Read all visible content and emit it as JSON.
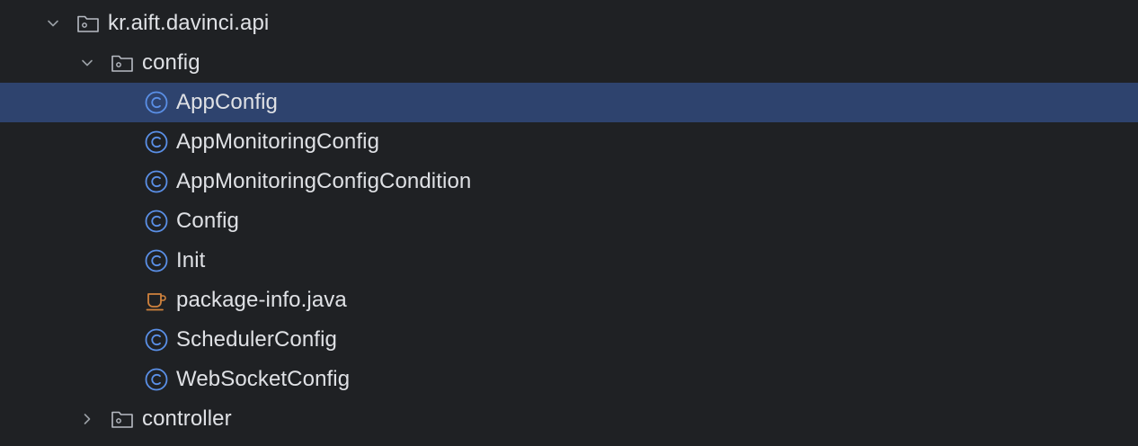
{
  "tree": {
    "root": {
      "label": "kr.aift.davinci.api",
      "icon": "package-folder-icon",
      "expanded": true
    },
    "config_folder": {
      "label": "config",
      "icon": "package-folder-icon",
      "expanded": true
    },
    "files": [
      {
        "label": "AppConfig",
        "icon": "class-icon",
        "selected": true
      },
      {
        "label": "AppMonitoringConfig",
        "icon": "class-icon",
        "selected": false
      },
      {
        "label": "AppMonitoringConfigCondition",
        "icon": "class-icon",
        "selected": false
      },
      {
        "label": "Config",
        "icon": "class-icon",
        "selected": false
      },
      {
        "label": "Init",
        "icon": "class-icon",
        "selected": false
      },
      {
        "label": "package-info.java",
        "icon": "java-file-icon",
        "selected": false
      },
      {
        "label": "SchedulerConfig",
        "icon": "class-icon",
        "selected": false
      },
      {
        "label": "WebSocketConfig",
        "icon": "class-icon",
        "selected": false
      }
    ],
    "controller_folder": {
      "label": "controller",
      "icon": "package-folder-icon",
      "expanded": false
    }
  },
  "colors": {
    "background": "#1f2124",
    "selection": "#2e436e",
    "text": "#dfe1e5",
    "class_icon": "#5a8fe6",
    "java_icon": "#d0823d",
    "folder_icon": "#b8bcc4",
    "chevron": "#9aa0a6"
  }
}
